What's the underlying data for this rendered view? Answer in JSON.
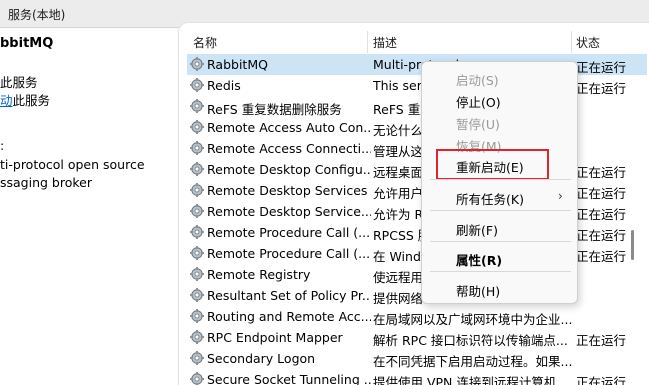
{
  "window": {
    "title": "服务(本地)"
  },
  "left_pane": {
    "heading": "bbitMQ",
    "line1": "此服务",
    "link_text": "动",
    "link_suffix": "此服务",
    "desc_label": ":",
    "desc_line1": "ti-protocol open source",
    "desc_line2": "ssaging broker"
  },
  "columns": {
    "name": "名称",
    "description": "描述",
    "status": "状态"
  },
  "services": [
    {
      "name": "RabbitMQ",
      "description": "Multi-protocol open source me...",
      "status": "正在运行",
      "selected": true
    },
    {
      "name": "Redis",
      "description": "This serv",
      "status": "正在运行"
    },
    {
      "name": "ReFS 重复数据删除服务",
      "description": "ReFS 重复",
      "status": ""
    },
    {
      "name": "Remote Access Auto Con...",
      "description": "无论什么",
      "status": ""
    },
    {
      "name": "Remote Access Connecti...",
      "description": "管理从这",
      "status": ""
    },
    {
      "name": "Remote Desktop Configu...",
      "description": "远程桌面",
      "status": "正在运行"
    },
    {
      "name": "Remote Desktop Services",
      "description": "允许用户",
      "status": "正在运行"
    },
    {
      "name": "Remote Desktop Service...",
      "description": "允许为 R",
      "status": "正在运行"
    },
    {
      "name": "Remote Procedure Call (...",
      "description": "RPCSS 服",
      "status": "正在运行"
    },
    {
      "name": "Remote Procedure Call (...",
      "description": "在 Windo",
      "status": "正在运行"
    },
    {
      "name": "Remote Registry",
      "description": "使远程用",
      "status": ""
    },
    {
      "name": "Resultant Set of Policy Pr...",
      "description": "提供网络",
      "status": ""
    },
    {
      "name": "Routing and Remote Acc...",
      "description": "在局域网以及广域网环境中为企业...",
      "status": ""
    },
    {
      "name": "RPC Endpoint Mapper",
      "description": "解析 RPC 接口标识符以传输端点...",
      "status": "正在运行"
    },
    {
      "name": "Secondary Logon",
      "description": "在不同凭据下启用启动过程。如果...",
      "status": ""
    },
    {
      "name": "Secure Socket Tunneling ...",
      "description": "提供使用 VPN 连接到远程计算机...",
      "status": "正在运行"
    }
  ],
  "context_menu": {
    "start": "启动(S)",
    "stop": "停止(O)",
    "pause": "暂停(U)",
    "resume": "恢复(M)",
    "restart": "重新启动(E)",
    "all_tasks": "所有任务(K)",
    "refresh": "刷新(F)",
    "properties": "属性(R)",
    "help": "帮助(H)"
  },
  "colors": {
    "selection": "#cde4f7",
    "highlight_box": "#e0242a",
    "link": "#0066cc"
  }
}
